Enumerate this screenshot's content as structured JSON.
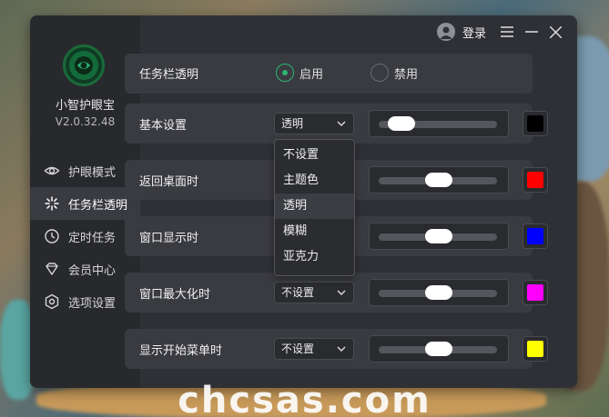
{
  "app": {
    "name": "小智护眼宝",
    "version": "V2.0.32.48"
  },
  "titlebar": {
    "login_label": "登录"
  },
  "sidebar": {
    "items": [
      {
        "label": "护眼模式",
        "icon": "eye-icon",
        "active": false
      },
      {
        "label": "任务栏透明",
        "icon": "sparkle-icon",
        "active": true
      },
      {
        "label": "定时任务",
        "icon": "clock-icon",
        "active": false
      },
      {
        "label": "会员中心",
        "icon": "diamond-icon",
        "active": false
      },
      {
        "label": "选项设置",
        "icon": "hexagon-settings-icon",
        "active": false
      }
    ]
  },
  "main": {
    "taskbar_toggle": {
      "label": "任务栏透明",
      "options": [
        "启用",
        "禁用"
      ],
      "selected": "启用"
    },
    "rows": [
      {
        "label": "基本设置",
        "mode": "透明",
        "slider": 0.1,
        "color": "#000000"
      },
      {
        "label": "返回桌面时",
        "mode": "",
        "slider": 0.5,
        "color": "#ff0000"
      },
      {
        "label": "窗口显示时",
        "mode": "",
        "slider": 0.5,
        "color": "#0000ff"
      },
      {
        "label": "窗口最大化时",
        "mode": "不设置",
        "slider": 0.5,
        "color": "#ff00ff"
      },
      {
        "label": "显示开始菜单时",
        "mode": "不设置",
        "slider": 0.5,
        "color": "#ffff00"
      }
    ],
    "dropdown": {
      "options": [
        "不设置",
        "主题色",
        "透明",
        "模糊",
        "亚克力"
      ],
      "selected": "透明"
    }
  },
  "colors": {
    "accent": "#2bb673",
    "window_bg": "#2f3035",
    "row_bg": "#3a3b40"
  },
  "watermark": "chcsas.com"
}
